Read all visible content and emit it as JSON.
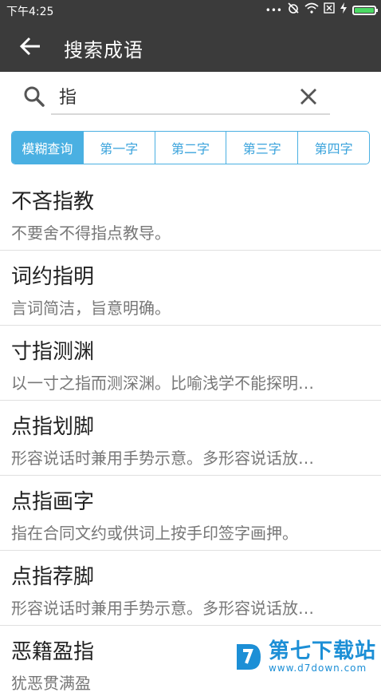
{
  "status_bar": {
    "time": "下午4:25",
    "icons": [
      "dots-icon",
      "alarm-off-icon",
      "wifi-icon",
      "sim-icon",
      "charging-icon",
      "battery-icon"
    ],
    "battery_level": 1.0,
    "colors": {
      "background": "#3b3b3b",
      "battery": "#4cd964"
    }
  },
  "app_bar": {
    "title": "搜索成语",
    "back_icon": "arrow-left-icon"
  },
  "search": {
    "value": "指",
    "placeholder": "",
    "search_icon": "search-icon",
    "clear_icon": "close-icon"
  },
  "filters": {
    "options": [
      "模糊查询",
      "第一字",
      "第二字",
      "第三字",
      "第四字"
    ],
    "selected": "模糊查询",
    "accent": "#4ab0e2"
  },
  "results": [
    {
      "title": "不吝指教",
      "desc": "不要舍不得指点教导。"
    },
    {
      "title": "词约指明",
      "desc": "言词简洁，旨意明确。"
    },
    {
      "title": "寸指测渊",
      "desc": "以一寸之指而测深渊。比喻浅学不能探明…"
    },
    {
      "title": "点指划脚",
      "desc": "形容说话时兼用手势示意。多形容说话放…"
    },
    {
      "title": "点指画字",
      "desc": "指在合同文约或供词上按手印签字画押。"
    },
    {
      "title": "点指荐脚",
      "desc": "形容说话时兼用手势示意。多形容说话放…"
    },
    {
      "title": "恶籍盈指",
      "desc": "犹恶贯满盈"
    }
  ],
  "watermark": {
    "main": "第七下载站",
    "sub": "www.d7down.com",
    "color": "#1c8fd6"
  }
}
